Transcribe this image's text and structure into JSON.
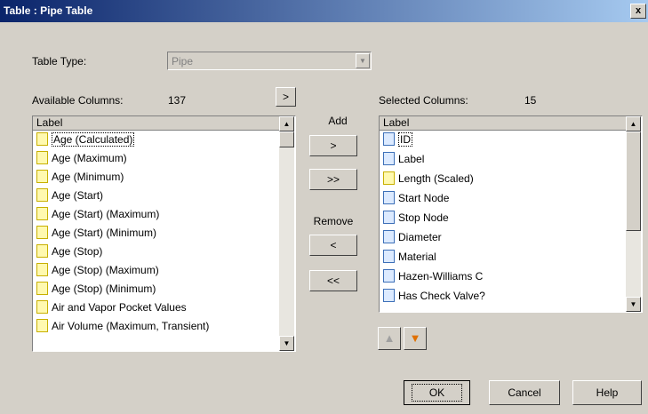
{
  "window": {
    "title": "Table : Pipe Table",
    "close_glyph": "x"
  },
  "table_type": {
    "label": "Table Type:",
    "value": "Pipe"
  },
  "available": {
    "label": "Available Columns:",
    "count": "137",
    "header": "Label",
    "items": [
      "Age (Calculated)",
      "Age (Maximum)",
      "Age (Minimum)",
      "Age (Start)",
      "Age (Start) (Maximum)",
      "Age (Start) (Minimum)",
      "Age (Stop)",
      "Age (Stop) (Maximum)",
      "Age (Stop) (Minimum)",
      "Air and Vapor Pocket Values",
      "Air Volume (Maximum, Transient)"
    ],
    "expand_button": ">"
  },
  "selected": {
    "label": "Selected Columns:",
    "count": "15",
    "header": "Label",
    "items": [
      {
        "text": "ID",
        "icon": "blue-page-icon"
      },
      {
        "text": "Label",
        "icon": "blue-page-icon"
      },
      {
        "text": "Length (Scaled)",
        "icon": "yellow-page-icon"
      },
      {
        "text": "Start Node",
        "icon": "blue-page-icon"
      },
      {
        "text": "Stop Node",
        "icon": "blue-page-icon"
      },
      {
        "text": "Diameter",
        "icon": "blue-page-icon"
      },
      {
        "text": "Material",
        "icon": "blue-page-icon"
      },
      {
        "text": "Hazen-Williams C",
        "icon": "blue-page-icon"
      },
      {
        "text": "Has Check Valve?",
        "icon": "blue-page-icon"
      }
    ]
  },
  "transfer": {
    "add_label": "Add",
    "add_one": ">",
    "add_all": ">>",
    "remove_label": "Remove",
    "remove_one": "<",
    "remove_all": "<<"
  },
  "buttons": {
    "ok": "OK",
    "cancel": "Cancel",
    "help": "Help"
  },
  "colors": {
    "title_start": "#0a246a",
    "title_end": "#a6caf0",
    "face": "#d4d0c8",
    "move_down_arrow": "#e07000"
  }
}
